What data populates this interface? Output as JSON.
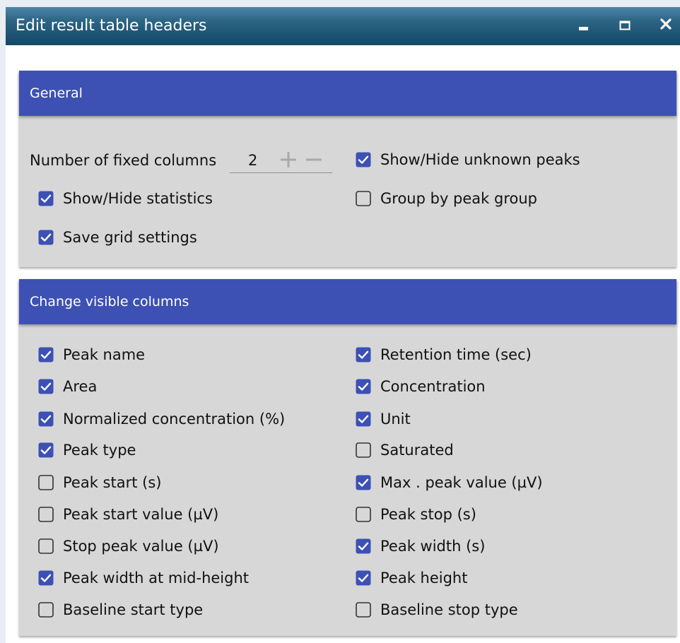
{
  "window": {
    "title": "Edit result table headers",
    "controls": [
      "minimize-icon",
      "maximize-icon",
      "close-icon"
    ]
  },
  "colors": {
    "titlebar": "#1e5577",
    "panel_header": "#3d51b4",
    "panel_body": "#d7d7d7",
    "checkbox_checked": "#3d51b4"
  },
  "general": {
    "title": "General",
    "fixed_columns_label": "Number of fixed columns",
    "fixed_columns_value": "2",
    "show_statistics": {
      "label": "Show/Hide statistics",
      "checked": true
    },
    "save_grid": {
      "label": "Save grid settings",
      "checked": true
    },
    "show_unknown": {
      "label": "Show/Hide unknown peaks",
      "checked": true
    },
    "group_by_peak": {
      "label": "Group by peak group",
      "checked": false
    }
  },
  "columns": {
    "title": "Change visible columns",
    "left": [
      {
        "label": "Peak name",
        "checked": true
      },
      {
        "label": "Area",
        "checked": true
      },
      {
        "label": "Normalized concentration (%)",
        "checked": true
      },
      {
        "label": "Peak type",
        "checked": true
      },
      {
        "label": "Peak start (s)",
        "checked": false
      },
      {
        "label": "Peak start value (µV)",
        "checked": false
      },
      {
        "label": "Stop peak value (µV)",
        "checked": false
      },
      {
        "label": "Peak width at mid-height",
        "checked": true
      },
      {
        "label": "Baseline start type",
        "checked": false
      }
    ],
    "right": [
      {
        "label": "Retention time (sec)",
        "checked": true
      },
      {
        "label": "Concentration",
        "checked": true
      },
      {
        "label": "Unit",
        "checked": true
      },
      {
        "label": "Saturated",
        "checked": false
      },
      {
        "label": "Max . peak value (µV)",
        "checked": true
      },
      {
        "label": "Peak stop (s)",
        "checked": false
      },
      {
        "label": "Peak width (s)",
        "checked": true
      },
      {
        "label": "Peak height",
        "checked": true
      },
      {
        "label": "Baseline stop type",
        "checked": false
      }
    ]
  }
}
